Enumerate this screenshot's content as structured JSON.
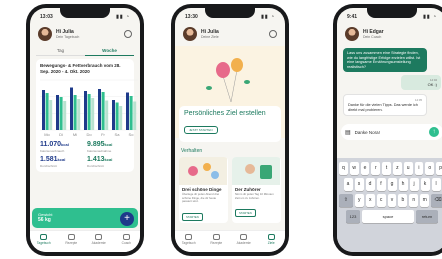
{
  "phone1": {
    "time": "13:03",
    "user_title": "Hi Julia",
    "user_subtitle": "Dein Tagebuch",
    "tabs": [
      "Tag",
      "Woche"
    ],
    "chart_title": "Bewegungs- & Fettverbrauch vom 28. Sep. 2020 - 4. Okt. 2020",
    "chart_data": {
      "type": "bar",
      "categories": [
        "Mo",
        "Di",
        "Mi",
        "Do",
        "Fr",
        "Sa",
        "So"
      ],
      "series": [
        {
          "values": [
            80,
            70,
            85,
            78,
            82,
            60,
            75
          ]
        },
        {
          "values": [
            74,
            66,
            70,
            72,
            76,
            55,
            68
          ]
        },
        {
          "values": [
            60,
            58,
            62,
            64,
            59,
            48,
            57
          ]
        }
      ]
    },
    "stats": [
      {
        "value": "11.070",
        "unit": "kcal",
        "label": "Kalorienverbrauch"
      },
      {
        "value": "9.895",
        "unit": "kcal",
        "label": "Kalorienaufnahme"
      },
      {
        "value": "1.581",
        "unit": "kcal",
        "label": "Durchschnitt"
      },
      {
        "value": "1.413",
        "unit": "kcal",
        "label": "Durchschnitt"
      }
    ],
    "goal_label": "Gewicht",
    "goal_value": "56 kg",
    "fab": "+",
    "nav": [
      "Tagebuch",
      "Rezepte",
      "Akademie",
      "Coach"
    ]
  },
  "phone2": {
    "time": "13:30",
    "user_title": "Hi Julia",
    "user_subtitle": "Deine Ziele",
    "hero_title": "Persönliches Ziel erstellen",
    "hero_button": "JETZT STARTEN",
    "section_title": "Verhalten",
    "cards": [
      {
        "title": "Drei schöne Dinge",
        "text": "Überlege dir jeden Abend drei schöne Dinge, die dir heute passiert sind.",
        "button": "STARTEN"
      },
      {
        "title": "Der Zuhörer",
        "text": "Nimm dir jeden Tag 10 Minuten Zeit um zu zuhören.",
        "button": "STARTEN"
      }
    ],
    "nav": [
      "Tagebuch",
      "Rezepte",
      "Akademie",
      "Ziele"
    ]
  },
  "phone3": {
    "time": "9:41",
    "user_title": "Hi Edgar",
    "user_subtitle": "Dein Coach",
    "msg_in": "Lass uns zusammen eine Strategie finden, wie du langfristige Erfolge erzielen willst. Ist eine langsame Ernährungsumstellung realistisch?",
    "msg_out": "OK :)",
    "msg_out_time": "14:02",
    "msg_in2": "Danke für die vielen Tipps. Das werde ich direkt mal probieren.",
    "msg_in2_time": "14:05",
    "composer_text": "Danke Nora!",
    "send": "↑",
    "keyboard": {
      "row1": [
        "q",
        "w",
        "e",
        "r",
        "t",
        "z",
        "u",
        "i",
        "o",
        "p"
      ],
      "row2": [
        "a",
        "s",
        "d",
        "f",
        "g",
        "h",
        "j",
        "k",
        "l"
      ],
      "row3": [
        "⇧",
        "y",
        "x",
        "c",
        "v",
        "b",
        "n",
        "m",
        "⌫"
      ],
      "row4": [
        "123",
        "space",
        "return"
      ]
    }
  }
}
